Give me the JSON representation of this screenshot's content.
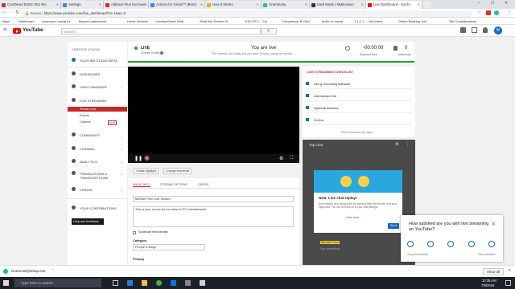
{
  "tabs": [
    {
      "label": "Combined EDSC 801 Wo",
      "color": "#c0392b"
    },
    {
      "label": "Settings",
      "color": "#4285f4"
    },
    {
      "label": "Adblock Plus has been",
      "color": "#d32f2f"
    },
    {
      "label": "Actions for Gmail™ (Beta)",
      "color": "#4285f4"
    },
    {
      "label": "How It Works",
      "color": "#f5a623"
    },
    {
      "label": "Grammarly",
      "color": "#15c39a"
    },
    {
      "label": "Dark Mode | MyBrowser",
      "color": "#333333"
    },
    {
      "label": "Live Dashboard - YouTu",
      "color": "#ff0000"
    }
  ],
  "address": {
    "secure_label": "Secure",
    "url": "https://www.youtube.com/live_dashboard?ar=1&ac=0"
  },
  "bookmarks": [
    "Apps",
    "Dashboard",
    "Lawrence Lessig Le",
    "Beyond passwords:",
    "Home Devices",
    "LocationSmart Web",
    "What the Golden St",
    "EDCSS 1 - Cal",
    "Comparison B-OAU",
    "Index of /users",
    "1.1.1.1 — the Intern",
    "Online Banking Unit",
    "Tax Considerations"
  ],
  "header": {
    "logo": "YouTube",
    "search_placeholder": "Search",
    "avatar": "M"
  },
  "sidebar": {
    "title": "CREATOR STUDIO",
    "studio_beta": "YOUTUBE STUDIO BETA",
    "items": [
      {
        "label": "DASHBOARD"
      },
      {
        "label": "VIDEO MANAGER"
      },
      {
        "label": "LIVE STREAMING"
      },
      {
        "label": "COMMUNITY"
      },
      {
        "label": "CHANNEL"
      },
      {
        "label": "ANALYTICS"
      },
      {
        "label": "TRANSLATIONS &"
      },
      {
        "label": "CREATE"
      },
      {
        "label": "YOUR CONTRIBUTIONS"
      }
    ],
    "translations_line2": "TRANSCRIPTIONS",
    "sub_items": [
      "Stream now",
      "Events",
      "Camera"
    ],
    "new_badge": "NEW",
    "help_button": "Help and feedback"
  },
  "status": {
    "live": "LIVE",
    "health": "Stream health",
    "you_are_live": "You are live",
    "message": "The internet can totally see you now. To stop, use your encoder.",
    "elapsed": "-00:00:00",
    "elapsed_label": "Elapsed time",
    "watching": "0",
    "watching_label": "watching"
  },
  "checklist": {
    "title": "LIVE STREAMING CHECKLIST",
    "items": [
      "Set up encoding software",
      "Add stream info",
      "Optional features",
      "Go live"
    ],
    "footer": "Don't show these tips again"
  },
  "video_actions": {
    "highlight": "Create highlight",
    "thumbnail": "Change thumbnail"
  },
  "form": {
    "tabs": [
      "BASIC INFO",
      "STREAM OPTIONS",
      "CARDS"
    ],
    "title_value": "Michael Flinn Live Stream",
    "description_value": "This is your source for the latest in PC entertainment",
    "schedule": "Schedule next stream",
    "category_label": "Category",
    "category_value": "People & Blogs",
    "privacy_label": "Privacy"
  },
  "chat": {
    "title": "Top chat",
    "card_title": "New: Live chat replay!",
    "card_text": "Now viewers who replay your live streams later will see the chat as it happened. You can turn this off in your chat settings.",
    "learn_more": "Learn more",
    "got_it": "Got it",
    "user": "Michael Flinn",
    "msg": "Say something..."
  },
  "survey": {
    "question": "How satisfied are you with live streaming on YouTube?",
    "left": "Very dissatisfied",
    "right": "Very satisfied"
  },
  "download": {
    "file": "GrammarlySetup.exe",
    "show_all": "Show all"
  },
  "taskbar": {
    "search": "Type here to search",
    "time": "10:35 AM",
    "date": "7/9/2018"
  }
}
